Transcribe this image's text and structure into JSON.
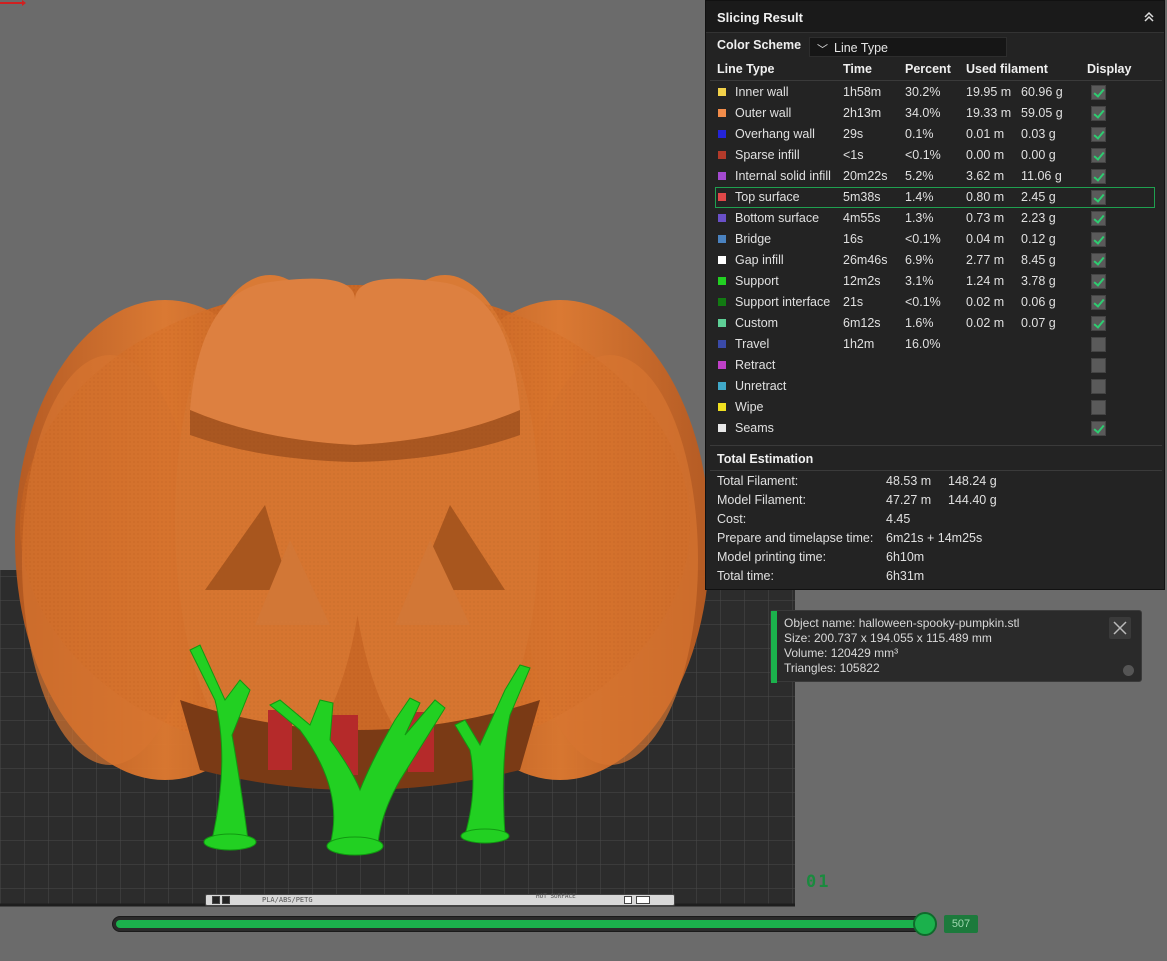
{
  "panel": {
    "title": "Slicing Result",
    "color_scheme_label": "Color Scheme",
    "color_scheme_value": "Line Type",
    "columns": {
      "line_type": "Line Type",
      "time": "Time",
      "percent": "Percent",
      "used_filament": "Used filament",
      "display": "Display"
    },
    "rows": [
      {
        "name": "Inner wall",
        "color": "#f2d14a",
        "time": "1h58m",
        "percent": "30.2%",
        "length": "19.95 m",
        "weight": "60.96 g",
        "display": true
      },
      {
        "name": "Outer wall",
        "color": "#f28c4a",
        "time": "2h13m",
        "percent": "34.0%",
        "length": "19.33 m",
        "weight": "59.05 g",
        "display": true
      },
      {
        "name": "Overhang wall",
        "color": "#2424d8",
        "time": "29s",
        "percent": "0.1%",
        "length": "0.01 m",
        "weight": "0.03 g",
        "display": true
      },
      {
        "name": "Sparse infill",
        "color": "#b23a2a",
        "time": "<1s",
        "percent": "<0.1%",
        "length": "0.00 m",
        "weight": "0.00 g",
        "display": true
      },
      {
        "name": "Internal solid infill",
        "color": "#a44ad0",
        "time": "20m22s",
        "percent": "5.2%",
        "length": "3.62 m",
        "weight": "11.06 g",
        "display": true
      },
      {
        "name": "Top surface",
        "color": "#e04848",
        "time": "5m38s",
        "percent": "1.4%",
        "length": "0.80 m",
        "weight": "2.45 g",
        "display": true
      },
      {
        "name": "Bottom surface",
        "color": "#6a50c8",
        "time": "4m55s",
        "percent": "1.3%",
        "length": "0.73 m",
        "weight": "2.23 g",
        "display": true
      },
      {
        "name": "Bridge",
        "color": "#4a82c0",
        "time": "16s",
        "percent": "<0.1%",
        "length": "0.04 m",
        "weight": "0.12 g",
        "display": true
      },
      {
        "name": "Gap infill",
        "color": "#ffffff",
        "time": "26m46s",
        "percent": "6.9%",
        "length": "2.77 m",
        "weight": "8.45 g",
        "display": true
      },
      {
        "name": "Support",
        "color": "#22d022",
        "time": "12m2s",
        "percent": "3.1%",
        "length": "1.24 m",
        "weight": "3.78 g",
        "display": true
      },
      {
        "name": "Support interface",
        "color": "#127a12",
        "time": "21s",
        "percent": "<0.1%",
        "length": "0.02 m",
        "weight": "0.06 g",
        "display": true
      },
      {
        "name": "Custom",
        "color": "#5ecf96",
        "time": "6m12s",
        "percent": "1.6%",
        "length": "0.02 m",
        "weight": "0.07 g",
        "display": true
      },
      {
        "name": "Travel",
        "color": "#3a4aa8",
        "time": "1h2m",
        "percent": "16.0%",
        "length": "",
        "weight": "",
        "display": false
      },
      {
        "name": "Retract",
        "color": "#c040c8",
        "time": "",
        "percent": "",
        "length": "",
        "weight": "",
        "display": false
      },
      {
        "name": "Unretract",
        "color": "#40a8c8",
        "time": "",
        "percent": "",
        "length": "",
        "weight": "",
        "display": false
      },
      {
        "name": "Wipe",
        "color": "#f0e020",
        "time": "",
        "percent": "",
        "length": "",
        "weight": "",
        "display": false
      },
      {
        "name": "Seams",
        "color": "#e8e8e8",
        "time": "",
        "percent": "",
        "length": "",
        "weight": "",
        "display": true
      }
    ],
    "selected_row": "Top surface",
    "total_title": "Total Estimation",
    "estimation": [
      {
        "key": "Total Filament:",
        "v1": "48.53 m",
        "v2": "148.24 g"
      },
      {
        "key": "Model Filament:",
        "v1": "47.27 m",
        "v2": "144.40 g"
      },
      {
        "key": "Cost:",
        "v1": "4.45",
        "v2": ""
      },
      {
        "key": "Prepare and timelapse time:",
        "v1": "6m21s + 14m25s",
        "v2": ""
      },
      {
        "key": "Model printing time:",
        "v1": "6h10m",
        "v2": ""
      },
      {
        "key": "Total time:",
        "v1": "6h31m",
        "v2": ""
      }
    ]
  },
  "object_info": {
    "name": "Object name: halloween-spooky-pumpkin.stl",
    "size": "Size: 200.737 x 194.055 x 115.489 mm",
    "volume": "Volume: 120429 mm³",
    "triangles": "Triangles: 105822"
  },
  "viewport": {
    "plate_number": "01",
    "plate_strip_text": "PLA/ABS/PETG",
    "plate_strip_text2": "HOT SURFACE",
    "layer_value": "507",
    "layer_progress": 0.995
  },
  "colors": {
    "accent": "#1bb14c",
    "model": "#d4702a",
    "support": "#22d022",
    "panel_bg": "#232323"
  }
}
